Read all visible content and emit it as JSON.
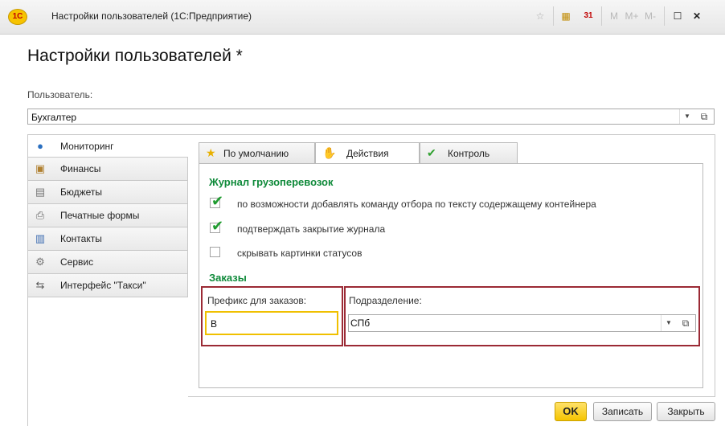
{
  "window": {
    "logo": "1С",
    "title": "Настройки пользователей (1С:Предприятие)",
    "toolbar": [
      "M",
      "M+",
      "M-"
    ],
    "calendar_day": "31"
  },
  "page_title": "Настройки пользователей *",
  "user": {
    "label": "Пользователь:",
    "value": "Бухгалтер"
  },
  "nav": [
    {
      "label": "Мониторинг",
      "icon": "globe-icon",
      "active": true
    },
    {
      "label": "Финансы",
      "icon": "finance-icon"
    },
    {
      "label": "Бюджеты",
      "icon": "calculator-icon"
    },
    {
      "label": "Печатные формы",
      "icon": "printer-icon"
    },
    {
      "label": "Контакты",
      "icon": "contacts-icon"
    },
    {
      "label": "Сервис",
      "icon": "gear-icon"
    },
    {
      "label": "Интерфейс \"Такси\"",
      "icon": "interface-icon"
    }
  ],
  "tabs": [
    {
      "label": "По умолчанию",
      "icon": "star-icon"
    },
    {
      "label": "Действия",
      "icon": "hand-icon",
      "active": true
    },
    {
      "label": "Контроль",
      "icon": "checkmark-icon"
    }
  ],
  "section_journal": {
    "title": "Журнал грузоперевозок",
    "options": [
      {
        "label": "по возможности добавлять команду отбора по тексту содержащему контейнера",
        "checked": true
      },
      {
        "label": "подтверждать закрытие журнала",
        "checked": true
      },
      {
        "label": "скрывать картинки статусов",
        "checked": false
      }
    ]
  },
  "section_orders": {
    "title": "Заказы",
    "prefix_label": "Префикс для заказов:",
    "prefix_value": "В",
    "division_label": "Подразделение:",
    "division_value": "СПб"
  },
  "buttons": {
    "ok": "OK",
    "save": "Записать",
    "close": "Закрыть"
  },
  "colors": {
    "section_title": "#0f8a3a",
    "highlight_border": "#9b2a35",
    "active_field_border": "#f0c000",
    "ok_button": "#f5c400"
  }
}
